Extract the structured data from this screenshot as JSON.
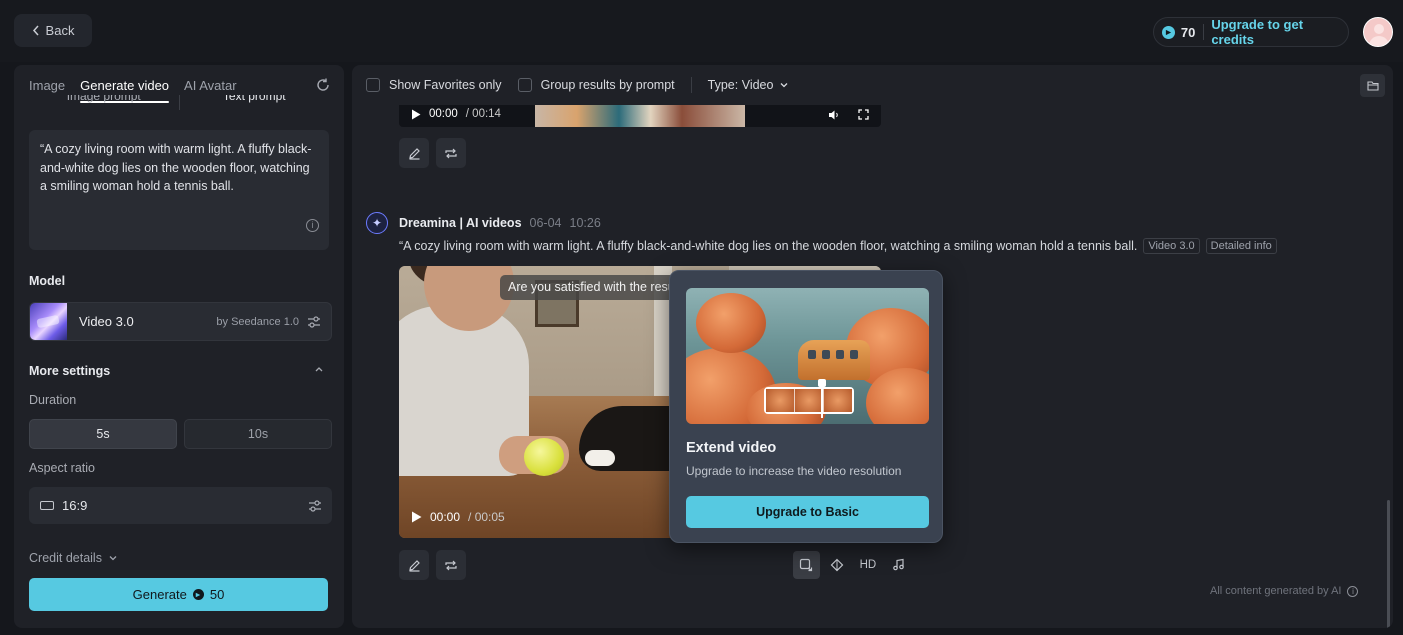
{
  "topbar": {
    "back_label": "Back",
    "credits_count": "70",
    "upgrade_label": "Upgrade to get credits"
  },
  "left": {
    "tabs": [
      {
        "label": "Image",
        "active": false
      },
      {
        "label": "Generate video",
        "active": true
      },
      {
        "label": "AI Avatar",
        "active": false
      }
    ],
    "prompt_subtabs": [
      "Image prompt",
      "Text prompt"
    ],
    "prompt_text": "“A cozy living room with warm light. A fluffy black-and-white dog lies on the wooden floor, watching a smiling woman hold a tennis ball.",
    "model_label": "Model",
    "model_name": "Video 3.0",
    "model_by": "by Seedance 1.0",
    "more_settings_label": "More settings",
    "duration_label": "Duration",
    "duration_options": [
      "5s",
      "10s"
    ],
    "duration_selected": "5s",
    "aspect_label": "Aspect ratio",
    "aspect_value": "16:9",
    "credit_details_label": "Credit details",
    "generate_label": "Generate",
    "generate_cost": "50"
  },
  "right": {
    "filters": {
      "favorites_label": "Show Favorites only",
      "group_label": "Group results by prompt",
      "type_label": "Type: Video"
    },
    "prev_video": {
      "time_current": "00:00",
      "time_total": "/ 00:14"
    },
    "message": {
      "author": "Dreamina | AI videos",
      "date": "06-04",
      "time": "10:26",
      "prompt": "“A cozy living room with warm light. A fluffy black-and-white dog lies on the wooden floor, watching a smiling woman hold a tennis ball.",
      "tags": [
        "Video 3.0",
        "Detailed info"
      ],
      "satisfied_text": "Are you satisfied with the results?",
      "time_current": "00:00",
      "time_total": "/ 00:05",
      "hd_label": "HD"
    },
    "footer_note": "All content generated by AI"
  },
  "popup": {
    "title": "Extend video",
    "subtitle": "Upgrade to increase the video resolution",
    "button_label": "Upgrade to Basic"
  },
  "colors": {
    "accent": "#56c9e1",
    "background": "#15171c",
    "panel": "#1f2127"
  }
}
